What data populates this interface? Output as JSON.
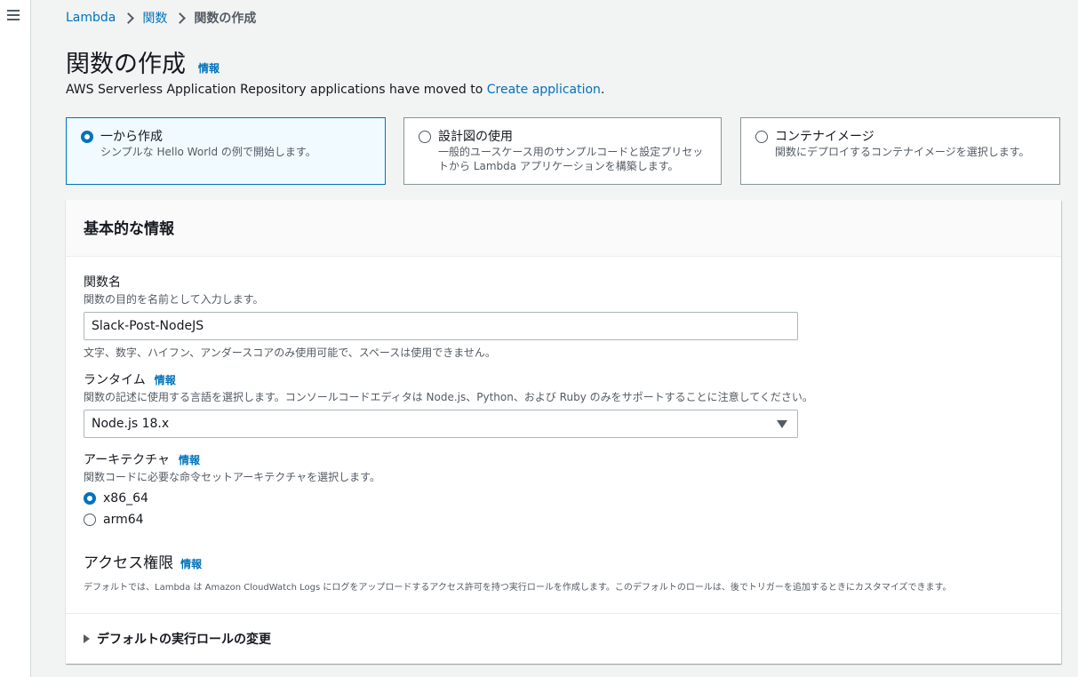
{
  "breadcrumb": {
    "items": [
      "Lambda",
      "関数"
    ],
    "current": "関数の作成"
  },
  "page": {
    "title": "関数の作成",
    "info": "情報",
    "moved_prefix": "AWS Serverless Application Repository applications have moved to ",
    "moved_link": "Create application",
    "moved_suffix": "."
  },
  "tiles": [
    {
      "title": "一から作成",
      "desc": "シンプルな Hello World の例で開始します。",
      "selected": true
    },
    {
      "title": "設計図の使用",
      "desc": "一般的ユースケース用のサンプルコードと設定プリセットから Lambda アプリケーションを構築します。",
      "selected": false
    },
    {
      "title": "コンテナイメージ",
      "desc": "関数にデプロイするコンテナイメージを選択します。",
      "selected": false
    }
  ],
  "basic_info": {
    "heading": "基本的な情報",
    "function_name": {
      "label": "関数名",
      "desc": "関数の目的を名前として入力します。",
      "value": "Slack-Post-NodeJS",
      "constraint": "文字、数字、ハイフン、アンダースコアのみ使用可能で、スペースは使用できません。"
    },
    "runtime": {
      "label": "ランタイム",
      "info": "情報",
      "desc": "関数の記述に使用する言語を選択します。コンソールコードエディタは Node.js、Python、および Ruby のみをサポートすることに注意してください。",
      "value": "Node.js 18.x"
    },
    "architecture": {
      "label": "アーキテクチャ",
      "info": "情報",
      "desc": "関数コードに必要な命令セットアーキテクチャを選択します。",
      "options": [
        "x86_64",
        "arm64"
      ],
      "selected": "x86_64"
    },
    "permissions": {
      "title": "アクセス権限",
      "info": "情報",
      "desc": "デフォルトでは、Lambda は Amazon CloudWatch Logs にログをアップロードするアクセス許可を持つ実行ロールを作成します。このデフォルトのロールは、後でトリガーを追加するときにカスタマイズできます。"
    },
    "expander_label": "デフォルトの実行ロールの変更"
  },
  "colors": {
    "link": "#0073bb",
    "selected_border": "#0073bb",
    "selected_bg": "#f1faff"
  }
}
